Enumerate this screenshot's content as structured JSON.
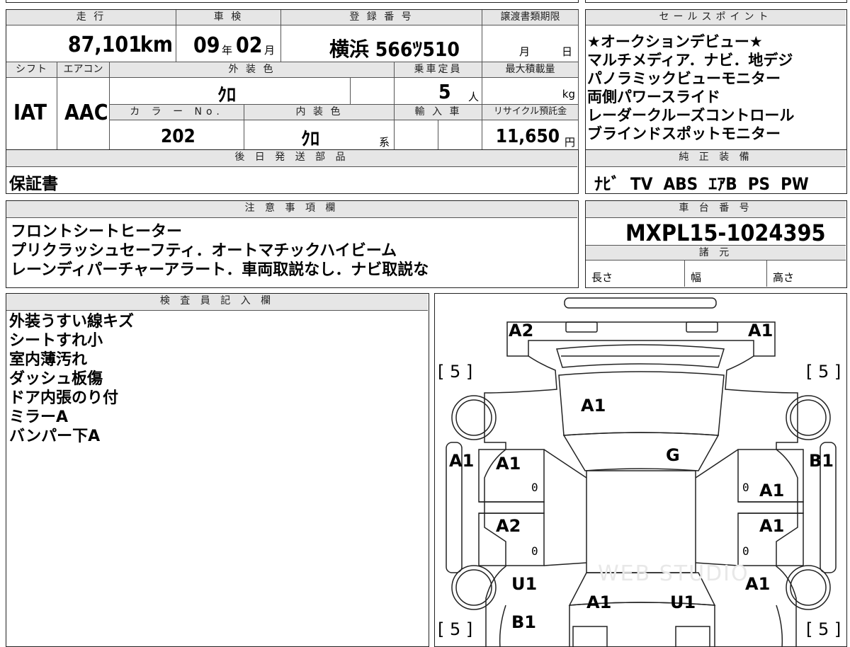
{
  "vehicle": {
    "mileage_header": "走 行",
    "mileage": "87,101",
    "mileage_unit": "km",
    "inspection_header": "車 検",
    "inspection_year": "09",
    "year_unit": "年",
    "inspection_month": "02",
    "month_unit": "月",
    "reg_header": "登 録 番 号",
    "reg_number": "横浜 566ﾂ510",
    "transfer_header": "譲渡書類期限",
    "transfer_month_unit": "月",
    "transfer_day_unit": "日",
    "shift_header": "シフト",
    "aircon_header": "エアコン",
    "shift": "IAT",
    "aircon": "AAC",
    "exterior_header": "外 装 色",
    "exterior_color": "ｸﾛ",
    "capacity_header": "乗車定員",
    "capacity": "5",
    "capacity_unit": "人",
    "load_header": "最大積載量",
    "load_unit": "kg",
    "color_no_header": "カ ラ ー No.",
    "color_no": "202",
    "interior_header": "内 装 色",
    "interior_color": "ｸﾛ",
    "interior_unit": "系",
    "import_header": "輸 入 車",
    "recycle_header": "リサイクル預託金",
    "recycle_fee": "11,650",
    "recycle_unit": "円"
  },
  "sales_points": {
    "header": "セールスポイント",
    "items": [
      "★オークションデビュー★",
      "マルチメディア．ナビ．地デジ",
      "パノラミックビューモニター",
      "両側パワースライド",
      "レーダークルーズコントロール",
      "ブラインドスポットモニター"
    ]
  },
  "later_parts": {
    "header": "後 日 発 送 部 品",
    "value": "保証書"
  },
  "genuine_equipment": {
    "header": "純 正 装 備",
    "value": "ﾅﾋﾞ  TV  ABS  ｴｱB  PS  PW"
  },
  "notes": {
    "header": "注 意 事 項 欄",
    "lines": [
      "フロントシートヒーター",
      "プリクラッシュセーフティ．オートマチックハイビーム",
      "レーンディパーチャーアラート．車両取説なし．ナビ取説な"
    ]
  },
  "chassis": {
    "header": "車 台 番 号",
    "value": "MXPL15-1024395",
    "spec_header": "諸 元",
    "length_label": "長さ",
    "width_label": "幅",
    "height_label": "高さ"
  },
  "inspector": {
    "header": "検 査 員 記 入 欄",
    "lines": [
      "外装うすい線キズ",
      "シートすれ小",
      "室内薄汚れ",
      "ダッシュ板傷",
      "ドア内張のり付",
      "ミラーA",
      "バンパー下A"
    ]
  },
  "diagram": {
    "tires": [
      "[ 5 ]",
      "[ 5 ]",
      "[ 5 ]",
      "[ 5 ]"
    ],
    "marks": {
      "front_left_corner": "A2",
      "front_right_corner": "A1",
      "hood": "A1",
      "left_fender": "A1",
      "windshield": "G",
      "right_fender": "B1",
      "left_front_door": "A1",
      "left_front_door_zero": "0",
      "right_front_door": "A1",
      "right_front_door_zero": "0",
      "left_rear_door": "A2",
      "left_rear_door_zero": "0",
      "right_rear_door": "A1",
      "right_rear_door_zero": "0",
      "left_rear_quarter": "U1",
      "right_rear_quarter": "A1",
      "rear_left": "A1",
      "rear_right": "U1",
      "rear_bumper_left": "B1"
    },
    "watermark": "WEB STUDIO"
  }
}
